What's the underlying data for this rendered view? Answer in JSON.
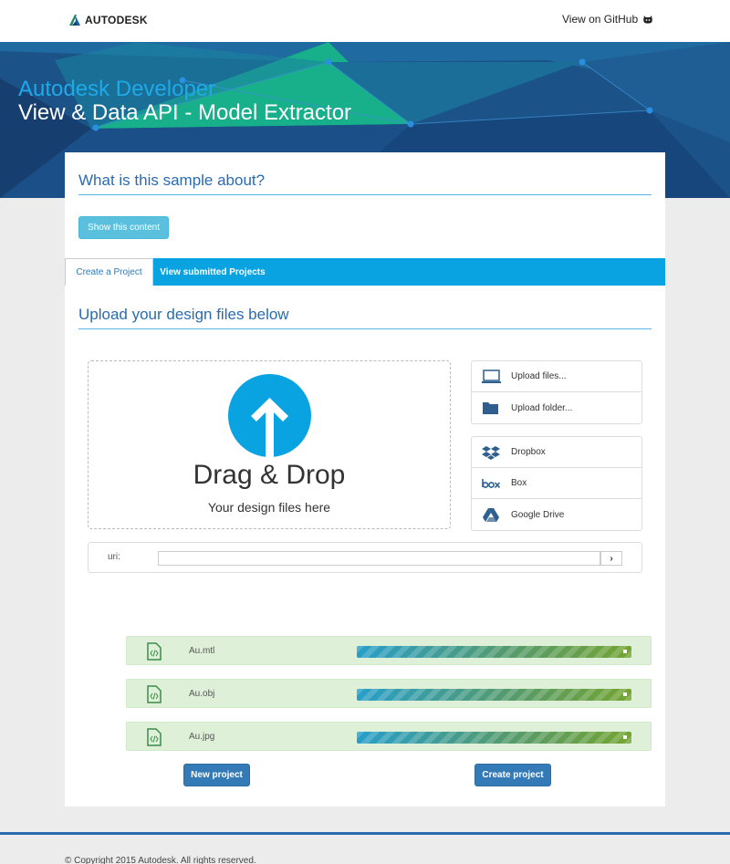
{
  "header": {
    "brand": "AUTODESK",
    "github_label": "View on GitHub"
  },
  "hero": {
    "subtitle": "Autodesk Developer",
    "title": "View & Data API - Model Extractor"
  },
  "about": {
    "heading": "What is this sample about?",
    "show_button": "Show this content"
  },
  "tabs": [
    {
      "label": "Create a Project",
      "active": true
    },
    {
      "label": "View submitted Projects",
      "active": false
    }
  ],
  "upload": {
    "heading": "Upload your design files below",
    "dropzone_title": "Drag & Drop",
    "dropzone_subtitle": "Your design files here",
    "local_sources": [
      {
        "label": "Upload files...",
        "icon": "laptop-icon"
      },
      {
        "label": "Upload folder...",
        "icon": "folder-icon"
      }
    ],
    "cloud_sources": [
      {
        "label": "Dropbox",
        "icon": "dropbox-icon"
      },
      {
        "label": "Box",
        "icon": "box-icon"
      },
      {
        "label": "Google Drive",
        "icon": "google-drive-icon"
      }
    ],
    "uri_label": "uri:",
    "uri_value": "",
    "uri_go": "›"
  },
  "files": [
    {
      "name": "Au.mtl",
      "progress": 100
    },
    {
      "name": "Au.obj",
      "progress": 100
    },
    {
      "name": "Au.jpg",
      "progress": 100
    }
  ],
  "actions": {
    "new_project": "New project",
    "create_project": "Create project"
  },
  "footer": {
    "copyright": "© Copyright 2015 Autodesk. All rights reserved."
  },
  "colors": {
    "accent": "#0aa3e2",
    "primary": "#337ab7",
    "heading": "#2a6bb0",
    "success_bg": "#dff0d8"
  }
}
